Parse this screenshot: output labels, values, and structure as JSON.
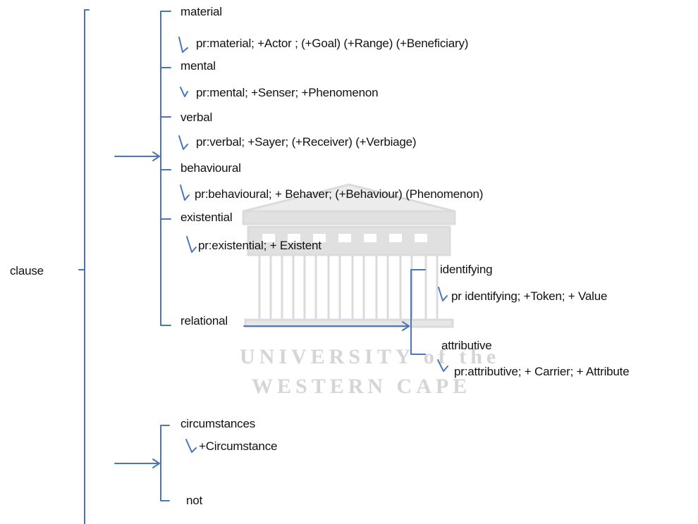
{
  "colors": {
    "line": "#4a76b8",
    "text": "#111111",
    "watermark": "#c4c4c4"
  },
  "root": "clause",
  "process_types": {
    "material": {
      "label": "material",
      "realization": "pr:material;  +Actor  ; (+Goal)  (+Range)  (+Beneficiary)"
    },
    "mental": {
      "label": "mental",
      "realization": "pr:mental;  +Senser;  +Phenomenon"
    },
    "verbal": {
      "label": "verbal",
      "realization": "pr:verbal;  +Sayer;  (+Receiver)  (+Verbiage)"
    },
    "behavioural": {
      "label": "behavioural",
      "realization": "pr:behavioural;  + Behaver;  (+Behaviour)  (Phenomenon)"
    },
    "existential": {
      "label": "existential",
      "realization": "pr:existential;  + Existent"
    },
    "relational": {
      "label": "relational",
      "identifying": {
        "label": "identifying",
        "realization": "pr identifying;  +Token;  + Value"
      },
      "attributive": {
        "label": "attributive",
        "realization": "pr:attributive;  + Carrier;  + Attribute"
      }
    }
  },
  "circumstance_system": {
    "circumstances": {
      "label": "circumstances",
      "realization": "+Circumstance"
    },
    "not": {
      "label": "not"
    }
  },
  "watermark": {
    "line1": "UNIVERSITY of the",
    "line2": "WESTERN CAPE",
    "logo": "university-building-logo"
  }
}
